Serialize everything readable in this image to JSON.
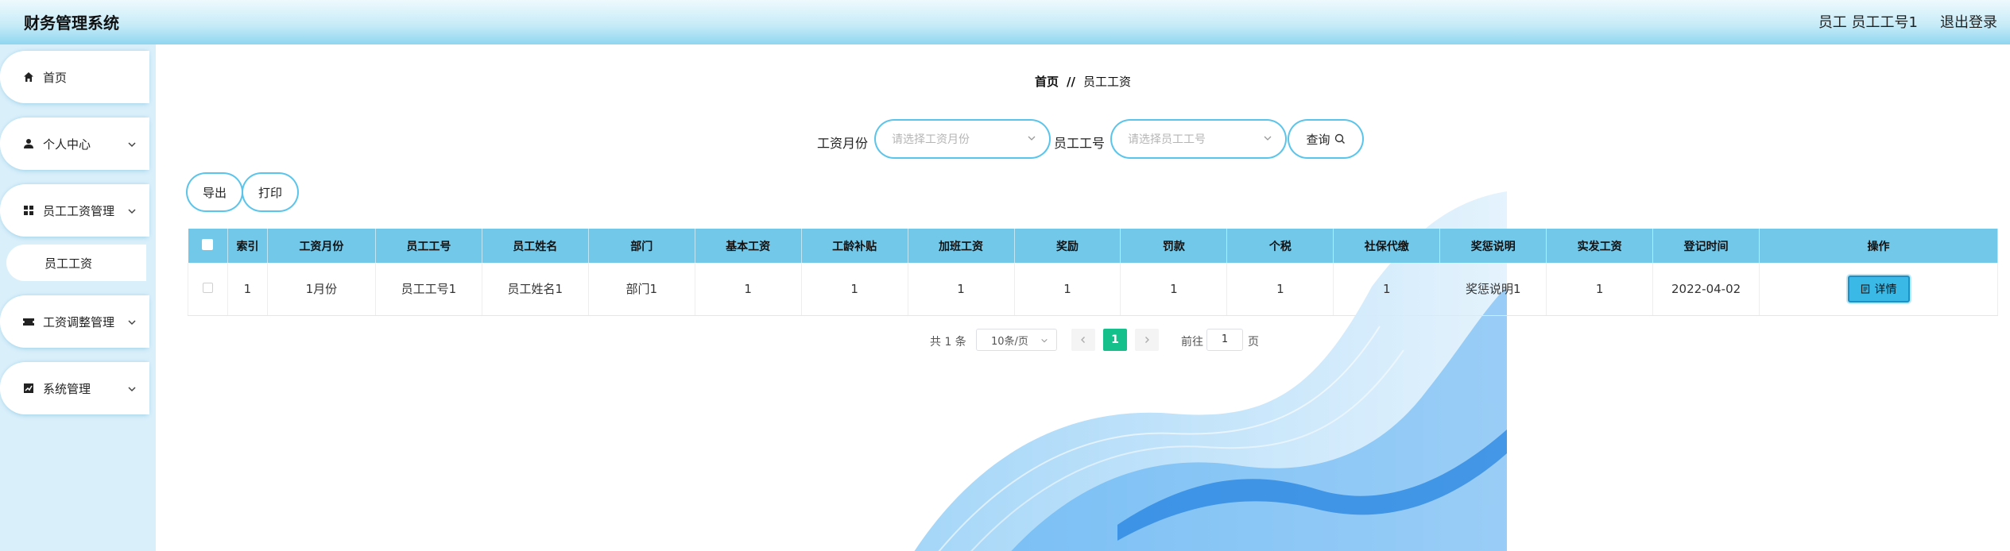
{
  "header": {
    "title": "财务管理系统",
    "user": "员工 员工工号1",
    "logout": "退出登录"
  },
  "sidebar": {
    "home": "首页",
    "personal": "个人中心",
    "salary_mgmt": "员工工资管理",
    "salary_sub": "员工工资",
    "salary_adjust": "工资调整管理",
    "system": "系统管理"
  },
  "breadcrumb": {
    "home": "首页",
    "sep": "//",
    "current": "员工工资"
  },
  "filters": {
    "month_label": "工资月份",
    "month_placeholder": "请选择工资月份",
    "empno_label": "员工工号",
    "empno_placeholder": "请选择员工工号",
    "query": "查询"
  },
  "actions": {
    "export": "导出",
    "print": "打印"
  },
  "table": {
    "headers": [
      "索引",
      "工资月份",
      "员工工号",
      "员工姓名",
      "部门",
      "基本工资",
      "工龄补贴",
      "加班工资",
      "奖励",
      "罚款",
      "个税",
      "社保代缴",
      "奖惩说明",
      "实发工资",
      "登记时间",
      "操作"
    ],
    "rows": [
      [
        "1",
        "1月份",
        "员工工号1",
        "员工姓名1",
        "部门1",
        "1",
        "1",
        "1",
        "1",
        "1",
        "1",
        "1",
        "奖惩说明1",
        "1",
        "2022-04-02"
      ]
    ],
    "detail": "详情"
  },
  "pagination": {
    "total": "共 1 条",
    "page_size": "10条/页",
    "current_page": "1",
    "goto": "前往",
    "goto_value": "1",
    "page_unit": "页"
  },
  "colors": {
    "accent": "#72c8e9",
    "active_page": "#16c08a",
    "sidebar_bg": "#d9effa"
  }
}
